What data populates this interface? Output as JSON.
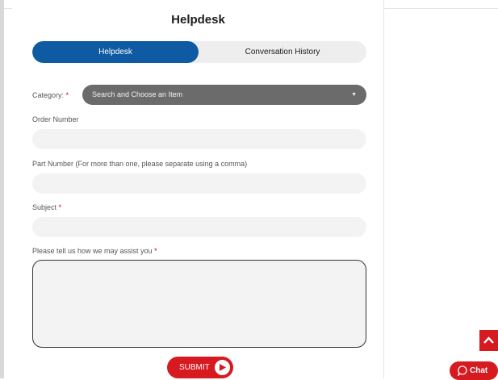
{
  "page": {
    "title": "Helpdesk"
  },
  "tabs": [
    {
      "label": "Helpdesk",
      "active": true
    },
    {
      "label": "Conversation History",
      "active": false
    }
  ],
  "form": {
    "category": {
      "label": "Category:",
      "required_mark": "*",
      "placeholder": "Search and Choose an Item",
      "caret": "▼"
    },
    "order_number": {
      "label": "Order Number",
      "value": ""
    },
    "part_number": {
      "label": "Part Number (For more than one, please separate using a comma)",
      "value": ""
    },
    "subject": {
      "label": "Subject",
      "required_mark": "*",
      "value": ""
    },
    "message": {
      "label": "Please tell us how we may assist you",
      "required_mark": "*",
      "value": ""
    },
    "submit_label": "SUBMIT"
  },
  "widgets": {
    "chat_label": "Chat",
    "scroll_top_icon": "chevron-up-icon"
  },
  "colors": {
    "primary": "#0e5aa3",
    "accent": "#d71920",
    "select_bg": "#6b6b6b",
    "field_bg": "#f3f3f3"
  }
}
